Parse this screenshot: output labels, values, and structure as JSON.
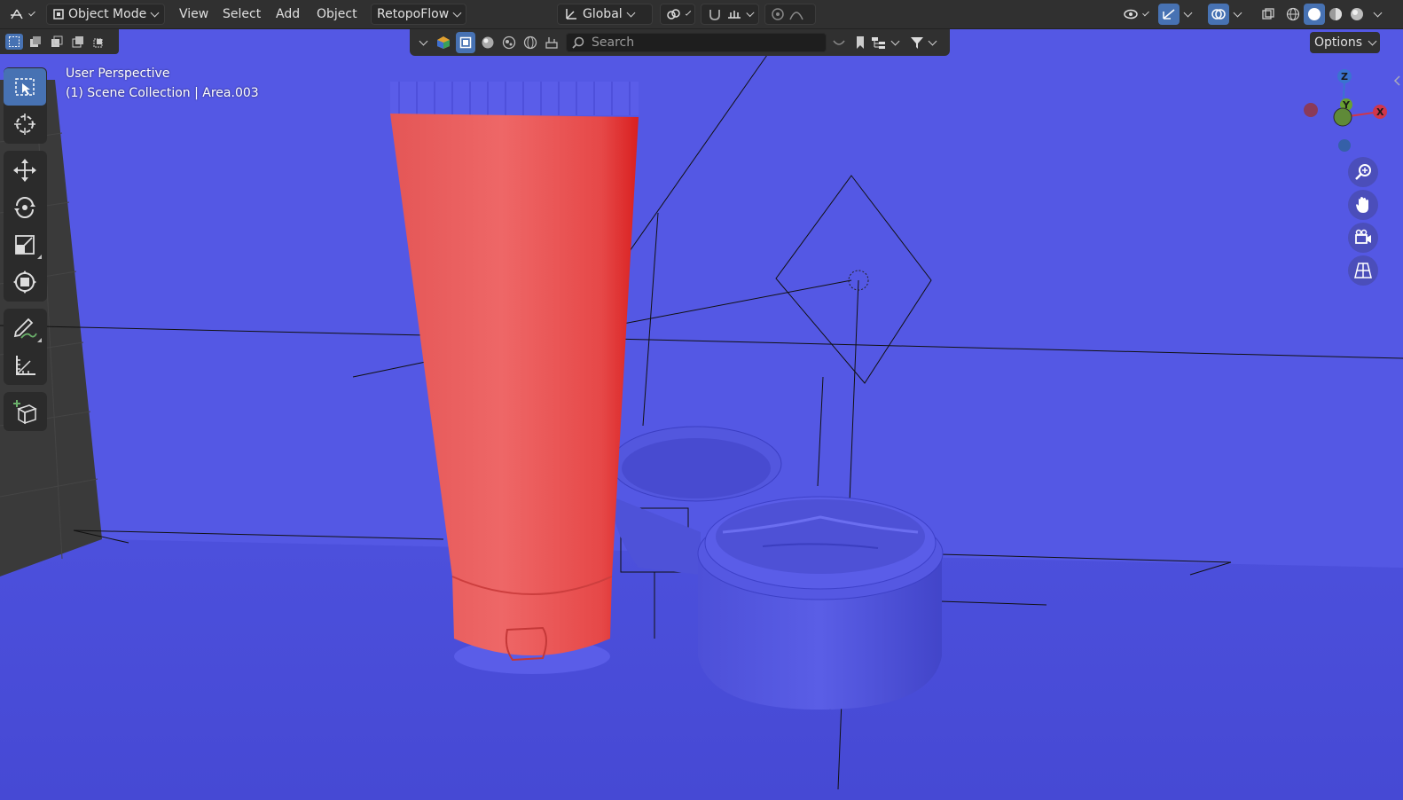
{
  "header": {
    "mode_label": "Object Mode",
    "menus": [
      "View",
      "Select",
      "Add",
      "Object"
    ],
    "addon_label": "RetopoFlow",
    "transform_orientation": "Global"
  },
  "outliner_filter": {
    "search_placeholder": "Search"
  },
  "options_label": "Options",
  "viewport": {
    "view_name": "User Perspective",
    "collection_info": "(1) Scene Collection | Area.003"
  },
  "gizmo": {
    "z_label": "Z",
    "y_label": "Y",
    "x_label": "X"
  },
  "toolbar": {
    "tools": [
      "select-box",
      "cursor",
      "move",
      "rotate",
      "scale",
      "transform",
      "annotate",
      "measure",
      "add-cube"
    ],
    "active_tool": "select-box"
  },
  "colors": {
    "viewport_bg": "#5458e4",
    "tube_red": "#e85a5a",
    "ui_dark": "#303030",
    "accent_blue": "#4772b3"
  }
}
